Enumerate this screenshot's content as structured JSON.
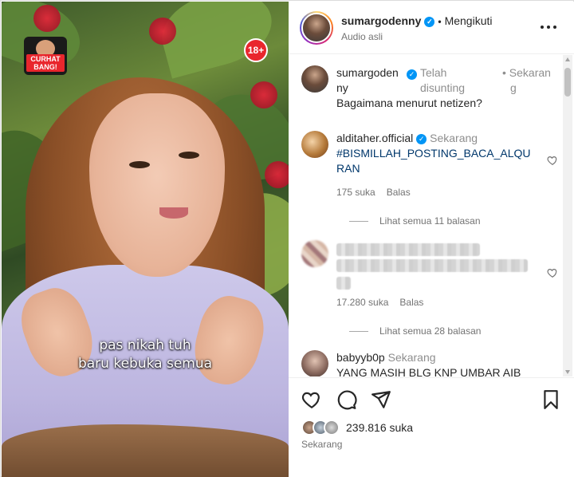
{
  "media": {
    "subtitle_line1": "pas nikah tuh",
    "subtitle_line2": "baru kebuka semua",
    "badge_text": "CURHAT BANG!",
    "rating_text": "18+"
  },
  "header": {
    "username": "sumargodenny",
    "separator": "•",
    "follow_status": "Mengikuti",
    "audio_label": "Audio asli",
    "more_icon": "more-horizontal-icon"
  },
  "comments": [
    {
      "username_line1": "sumargoden",
      "username_line2": "ny",
      "edited_line1": "Telah",
      "edited_line2": "disunting",
      "time_line1": "• Sekaran",
      "time_line2": "g",
      "text": "Bagaimana menurut netizen?"
    },
    {
      "username": "alditaher.official",
      "time": "Sekarang",
      "text_line1": "#BISMILLAH_POSTING_BACA_ALQU",
      "text_line2": "RAN",
      "likes": "175 suka",
      "reply": "Balas",
      "view_replies": "Lihat semua 11 balasan"
    },
    {
      "likes": "17.280 suka",
      "reply": "Balas",
      "view_replies": "Lihat semua 28 balasan"
    },
    {
      "username": "babyyb0p",
      "time": "Sekarang",
      "text": "YANG MASIH BLG KNP UMBAR AIB"
    }
  ],
  "actions": {
    "likes": "239.816 suka",
    "posted": "Sekarang"
  },
  "colors": {
    "link": "#00376b",
    "verified": "#0095f6",
    "muted": "#737373"
  }
}
